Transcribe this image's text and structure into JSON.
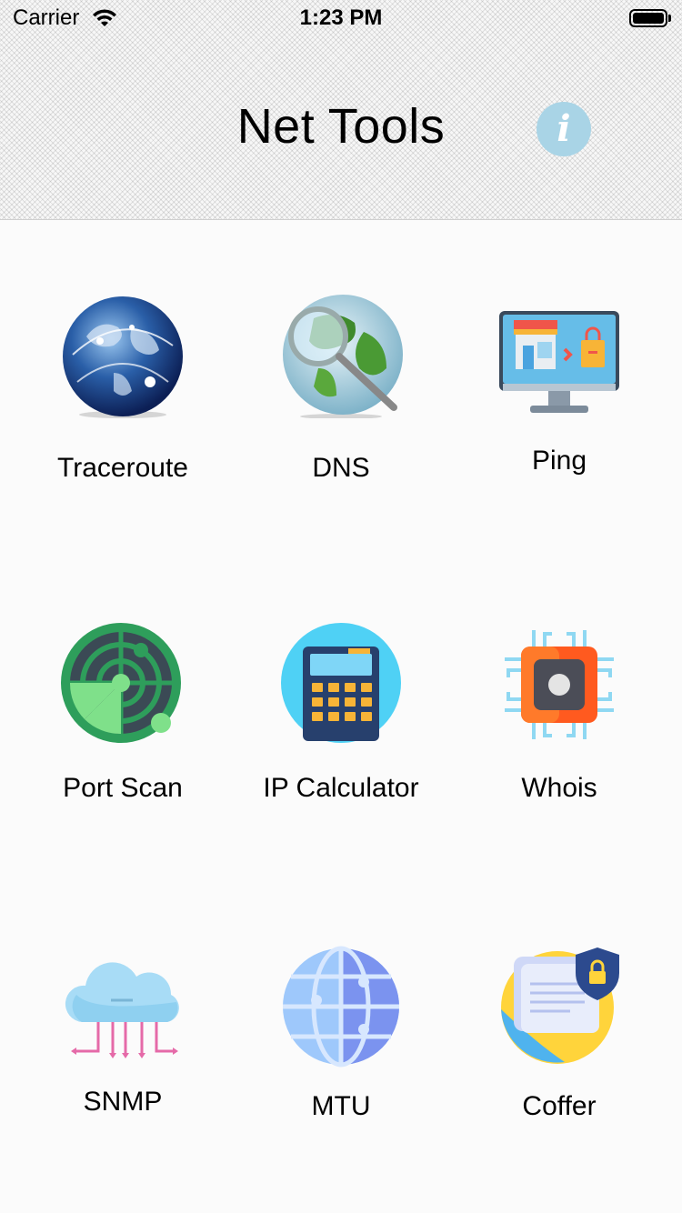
{
  "status_bar": {
    "carrier": "Carrier",
    "time": "1:23 PM"
  },
  "header": {
    "title": "Net Tools",
    "info_icon": "info-icon"
  },
  "tools": [
    {
      "label": "Traceroute",
      "icon": "globe-network-icon"
    },
    {
      "label": "DNS",
      "icon": "globe-magnifier-icon"
    },
    {
      "label": "Ping",
      "icon": "monitor-shop-icon"
    },
    {
      "label": "Port Scan",
      "icon": "radar-icon"
    },
    {
      "label": "IP Calculator",
      "icon": "calculator-icon"
    },
    {
      "label": "Whois",
      "icon": "chip-icon"
    },
    {
      "label": "SNMP",
      "icon": "cloud-icon"
    },
    {
      "label": "MTU",
      "icon": "globe-grid-icon"
    },
    {
      "label": "Coffer",
      "icon": "secure-document-icon"
    }
  ],
  "colors": {
    "info_button": "#a9d4e6",
    "background": "#fbfbfb"
  }
}
